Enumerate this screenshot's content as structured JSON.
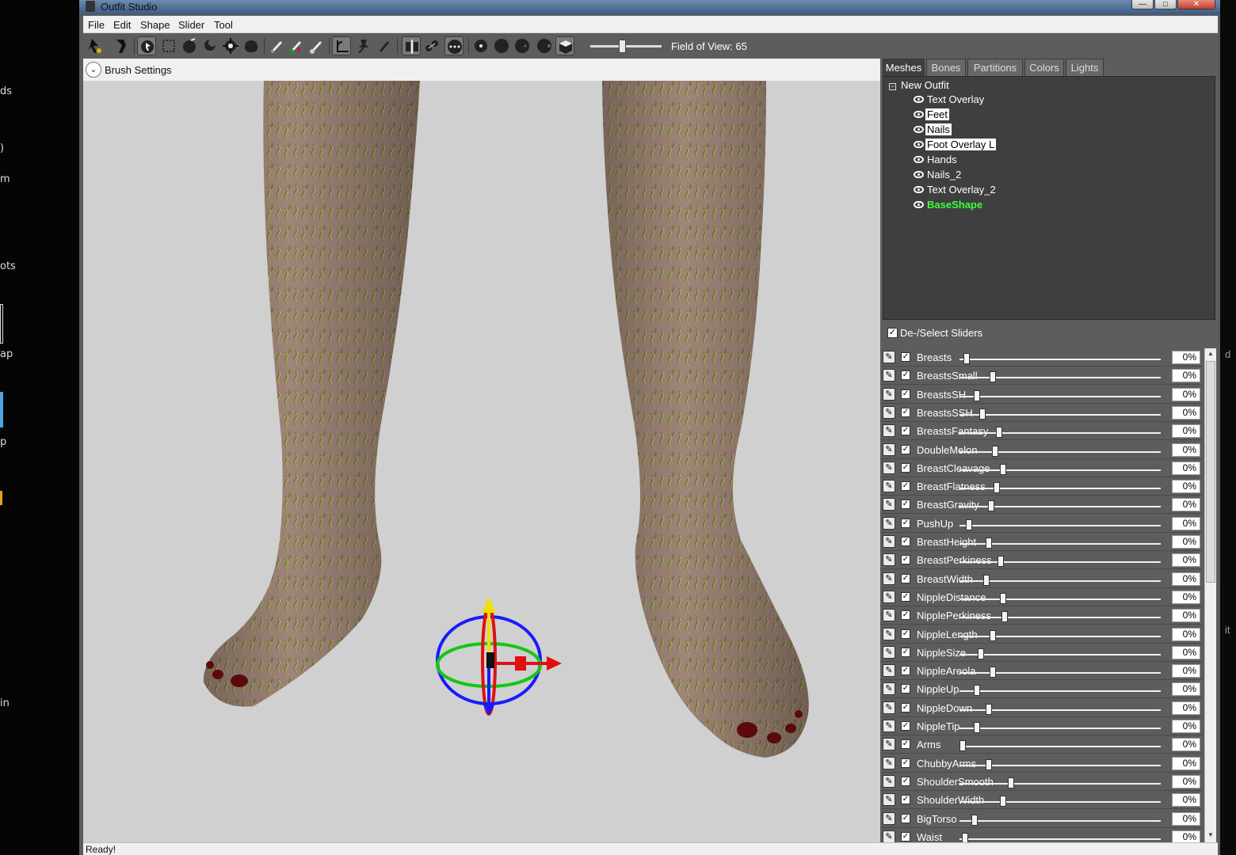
{
  "desktop": {
    "left_fragments": [
      "ds",
      ")",
      "m",
      "ots",
      "ap",
      "p",
      "in"
    ],
    "right_fragments": [
      "d",
      "it"
    ]
  },
  "window": {
    "title": "Outfit Studio",
    "controls": {
      "minimize": "—",
      "maximize": "□",
      "close": "✕"
    }
  },
  "menu": [
    "File",
    "Edit",
    "Shape",
    "Slider",
    "Tool"
  ],
  "toolbar": {
    "icons": [
      "select-brush",
      "pose-brush",
      "select-tool",
      "mask-brush",
      "inflate-brush",
      "deflate-brush",
      "move-brush",
      "smooth-brush",
      "undiff-brush",
      "weight-brush",
      "color-brush",
      "alpha-brush",
      "transform-tool",
      "pivot-tool",
      "vertex-edit-tool",
      "x-mirror",
      "connected-only",
      "global-brush",
      "brush-small",
      "brush-medium",
      "brush-large",
      "brush-xlarge",
      "3d-view"
    ],
    "fov_label": "Field of View: 65",
    "fov_value": 65
  },
  "brush_settings": {
    "label": "Brush Settings",
    "toggle_glyph": "⌄"
  },
  "status": "Ready!",
  "side_panel": {
    "tabs": [
      "Meshes",
      "Bones",
      "Partitions",
      "Colors",
      "Lights"
    ],
    "active_tab": "Meshes",
    "tree": {
      "root": "New Outfit",
      "items": [
        {
          "label": "Text Overlay",
          "state": "normal"
        },
        {
          "label": "Feet",
          "state": "selected"
        },
        {
          "label": "Nails",
          "state": "selected"
        },
        {
          "label": "Foot Overlay L",
          "state": "selected"
        },
        {
          "label": "Hands",
          "state": "normal"
        },
        {
          "label": "Nails_2",
          "state": "normal"
        },
        {
          "label": "Text Overlay_2",
          "state": "normal"
        },
        {
          "label": "BaseShape",
          "state": "active"
        }
      ]
    },
    "sliders_header": {
      "label": "De-/Select Sliders",
      "checked": true
    },
    "sliders": [
      {
        "name": "Breasts",
        "value": "0%",
        "pos": 0.02
      },
      {
        "name": "BreastsSmall",
        "value": "0%",
        "pos": 0.15
      },
      {
        "name": "BreastsSH",
        "value": "0%",
        "pos": 0.07
      },
      {
        "name": "BreastsSSH",
        "value": "0%",
        "pos": 0.1
      },
      {
        "name": "BreastsFantasy",
        "value": "0%",
        "pos": 0.18
      },
      {
        "name": "DoubleMelon",
        "value": "0%",
        "pos": 0.16
      },
      {
        "name": "BreastCleavage",
        "value": "0%",
        "pos": 0.2
      },
      {
        "name": "BreastFlatness",
        "value": "0%",
        "pos": 0.17
      },
      {
        "name": "BreastGravity",
        "value": "0%",
        "pos": 0.14
      },
      {
        "name": "PushUp",
        "value": "0%",
        "pos": 0.03
      },
      {
        "name": "BreastHeight",
        "value": "0%",
        "pos": 0.13
      },
      {
        "name": "BreastPerkiness",
        "value": "0%",
        "pos": 0.19
      },
      {
        "name": "BreastWidth",
        "value": "0%",
        "pos": 0.12
      },
      {
        "name": "NippleDistance",
        "value": "0%",
        "pos": 0.2
      },
      {
        "name": "NipplePerkiness",
        "value": "0%",
        "pos": 0.21
      },
      {
        "name": "NippleLength",
        "value": "0%",
        "pos": 0.15
      },
      {
        "name": "NippleSize",
        "value": "0%",
        "pos": 0.09
      },
      {
        "name": "NippleAreola",
        "value": "0%",
        "pos": 0.15
      },
      {
        "name": "NippleUp",
        "value": "0%",
        "pos": 0.07
      },
      {
        "name": "NippleDown",
        "value": "0%",
        "pos": 0.13
      },
      {
        "name": "NippleTip",
        "value": "0%",
        "pos": 0.07
      },
      {
        "name": "Arms",
        "value": "0%",
        "pos": 0.0
      },
      {
        "name": "ChubbyArms",
        "value": "0%",
        "pos": 0.13
      },
      {
        "name": "ShoulderSmooth",
        "value": "0%",
        "pos": 0.24
      },
      {
        "name": "ShoulderWidth",
        "value": "0%",
        "pos": 0.2
      },
      {
        "name": "BigTorso",
        "value": "0%",
        "pos": 0.06
      },
      {
        "name": "Waist",
        "value": "0%",
        "pos": 0.01
      }
    ]
  }
}
